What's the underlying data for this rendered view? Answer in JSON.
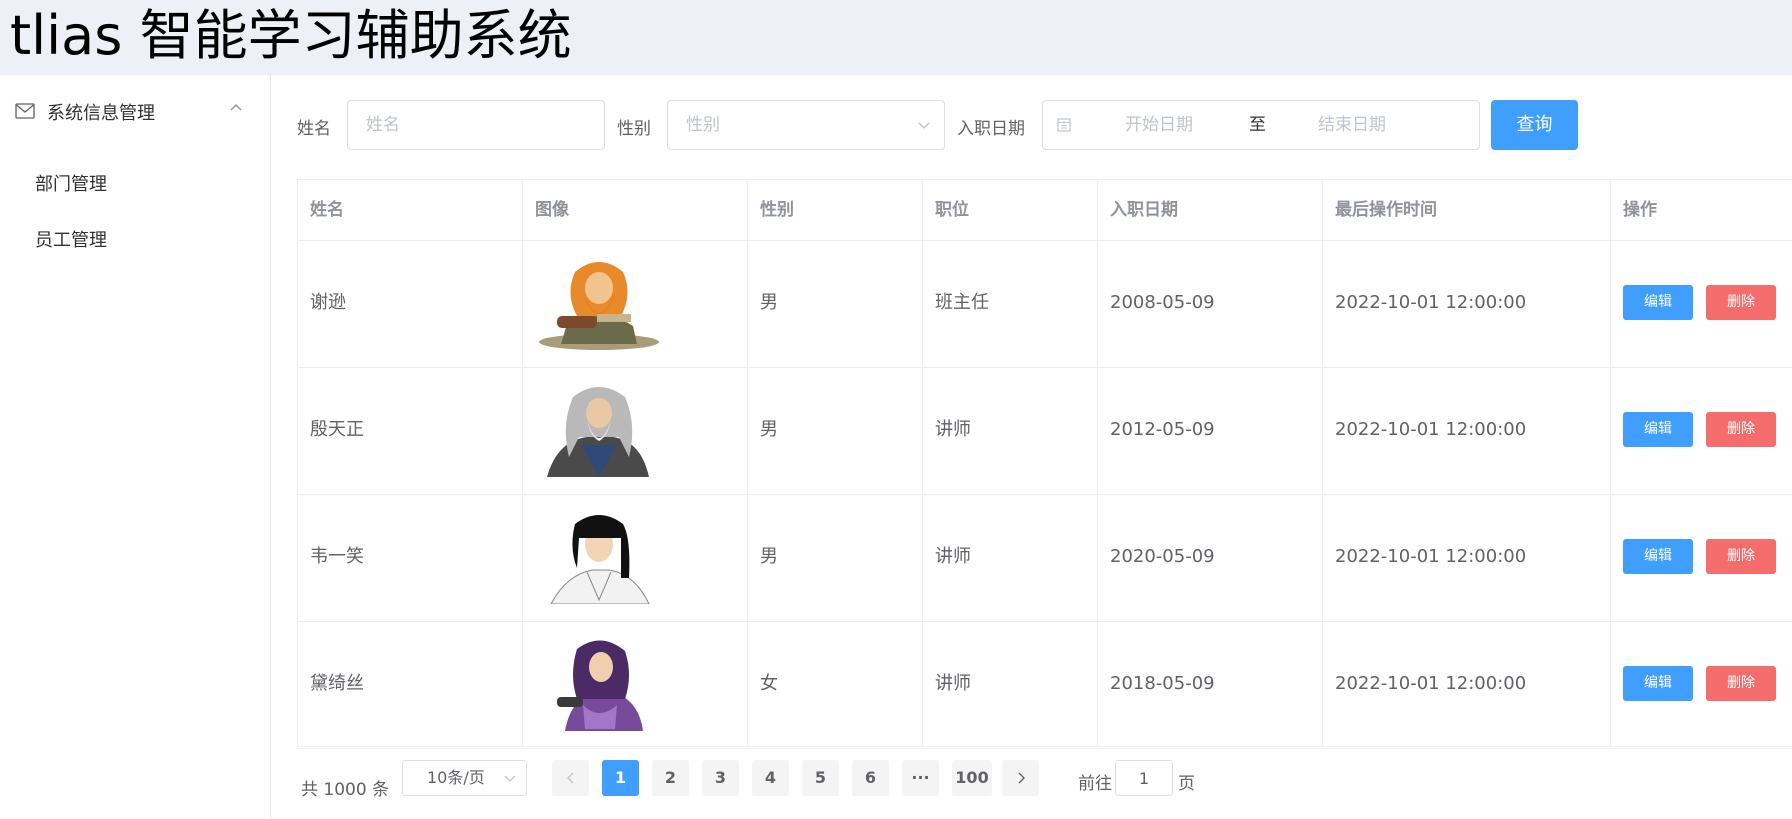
{
  "app": {
    "title": "tlias 智能学习辅助系统"
  },
  "sidebar": {
    "group_label": "系统信息管理",
    "items": [
      {
        "label": "部门管理"
      },
      {
        "label": "员工管理"
      }
    ]
  },
  "search": {
    "name_label": "姓名",
    "name_placeholder": "姓名",
    "gender_label": "性别",
    "gender_placeholder": "性别",
    "date_label": "入职日期",
    "start_placeholder": "开始日期",
    "range_separator": "至",
    "end_placeholder": "结束日期",
    "query_button": "查询"
  },
  "table": {
    "columns": [
      "姓名",
      "图像",
      "性别",
      "职位",
      "入职日期",
      "最后操作时间",
      "操作"
    ],
    "rows": [
      {
        "name": "谢逊",
        "avatar": "avatar-orange-bearded-warrior",
        "gender": "男",
        "position": "班主任",
        "hire_date": "2008-05-09",
        "last_op": "2022-10-01 12:00:00",
        "edit": "编辑",
        "delete": "删除"
      },
      {
        "name": "殷天正",
        "avatar": "avatar-grey-haired-elder",
        "gender": "男",
        "position": "讲师",
        "hire_date": "2012-05-09",
        "last_op": "2022-10-01 12:00:00",
        "edit": "编辑",
        "delete": "删除"
      },
      {
        "name": "韦一笑",
        "avatar": "avatar-black-haired-scholar",
        "gender": "男",
        "position": "讲师",
        "hire_date": "2020-05-09",
        "last_op": "2022-10-01 12:00:00",
        "edit": "编辑",
        "delete": "删除"
      },
      {
        "name": "黛绮丝",
        "avatar": "avatar-purple-hooded-woman",
        "gender": "女",
        "position": "讲师",
        "hire_date": "2018-05-09",
        "last_op": "2022-10-01 12:00:00",
        "edit": "编辑",
        "delete": "删除"
      }
    ]
  },
  "pagination": {
    "total": "共 1000 条",
    "page_size": "10条/页",
    "pages": [
      "1",
      "2",
      "3",
      "4",
      "5",
      "6"
    ],
    "ellipsis": "···",
    "last_page": "100",
    "goto_label": "前往",
    "goto_value": "1",
    "page_suffix": "页",
    "current_page": 1
  },
  "colors": {
    "primary": "#409eff",
    "danger": "#f56c6c",
    "header_bg": "#edf1f7"
  }
}
